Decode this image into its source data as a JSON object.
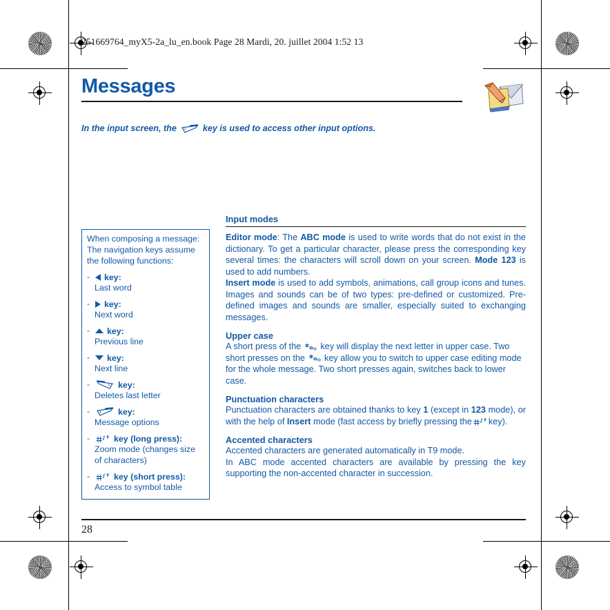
{
  "running_head": "251669764_myX5-2a_lu_en.book  Page 28  Mardi, 20. juillet 2004  1:52 13",
  "chapter": {
    "title": "Messages",
    "icon": "message-envelope-pen-icon"
  },
  "intro": {
    "before": "In the input screen, the",
    "key_icon": "right-soft-key-icon",
    "after": "key is used to access other input options."
  },
  "sidebar": {
    "lead": "When composing a message: The navigation keys assume the following functions:",
    "bullet": "-",
    "key_word": "key:",
    "items": [
      {
        "icon": "left-arrow-key-icon",
        "key_label": "key:",
        "description": "Last word"
      },
      {
        "icon": "right-arrow-key-icon",
        "key_label": "key:",
        "description": "Next word"
      },
      {
        "icon": "up-arrow-key-icon",
        "key_label": "key:",
        "description": "Previous line"
      },
      {
        "icon": "down-arrow-key-icon",
        "key_label": "key:",
        "description": "Next line"
      },
      {
        "icon": "left-soft-key-icon",
        "key_label": "key:",
        "description": "Deletes last letter"
      },
      {
        "icon": "right-soft-key-icon",
        "key_label": "key:",
        "description": "Message options"
      },
      {
        "icon": "hash-key-icon",
        "key_label": "key (long press):",
        "description": "Zoom mode (changes size of characters)"
      },
      {
        "icon": "hash-key-icon",
        "key_label": "key (short press):",
        "description": "Access to symbol table"
      }
    ]
  },
  "main": {
    "section_title": "Input modes",
    "editor": {
      "p1_b1": "Editor mode",
      "p1_t1": ": The ",
      "p1_b2": "ABC mode",
      "p1_t2": " is used to write words that do not exist in the dictionary. To get a particular character, please press the corresponding key several times: the characters will scroll down on your screen. ",
      "p1_b3": "Mode 123",
      "p1_t3": " is used to add numbers."
    },
    "insert": {
      "p2_b1": "Insert mode",
      "p2_t1": " is used to add symbols, animations, call group icons and tunes. Images and sounds can be of two types: pre-defined or customized. Pre-defined images and sounds are smaller, especially suited to exchanging messages."
    },
    "upper_case": {
      "heading": "Upper case",
      "t1": "A short press of the",
      "key1_icon": "star-key-icon",
      "t2": "key will display the next letter in upper case. Two short presses on the",
      "key2_icon": "star-key-icon",
      "t3": "key allow you to switch to upper case editing mode for the whole message. Two short presses again, switches back to lower case."
    },
    "punctuation": {
      "heading": "Punctuation characters",
      "t1": "Punctuation characters are obtained thanks to key ",
      "b1": "1",
      "t2": " (except in ",
      "b2": "123",
      "t3": " mode), or with the help of ",
      "b3": "Insert",
      "t4": " mode (fast access by briefly pressing the",
      "key_icon": "hash-key-icon",
      "t5": "key)."
    },
    "accented": {
      "heading": "Accented characters",
      "t1": "Accented characters are generated automatically in T9 mode.",
      "t2": "In ABC mode accented characters are available by pressing the key supporting the non-accented character in succession."
    }
  },
  "footer": {
    "page_number": "28"
  },
  "colors": {
    "brand_blue": "#1159a6",
    "rule_black": "#1a1a1a",
    "page_background": "#ffffff"
  },
  "print_marks": {
    "registration_icon": "registration-target-icon",
    "density_icon": "star-density-target-icon",
    "trim_icon": "trim-mark-icon"
  }
}
